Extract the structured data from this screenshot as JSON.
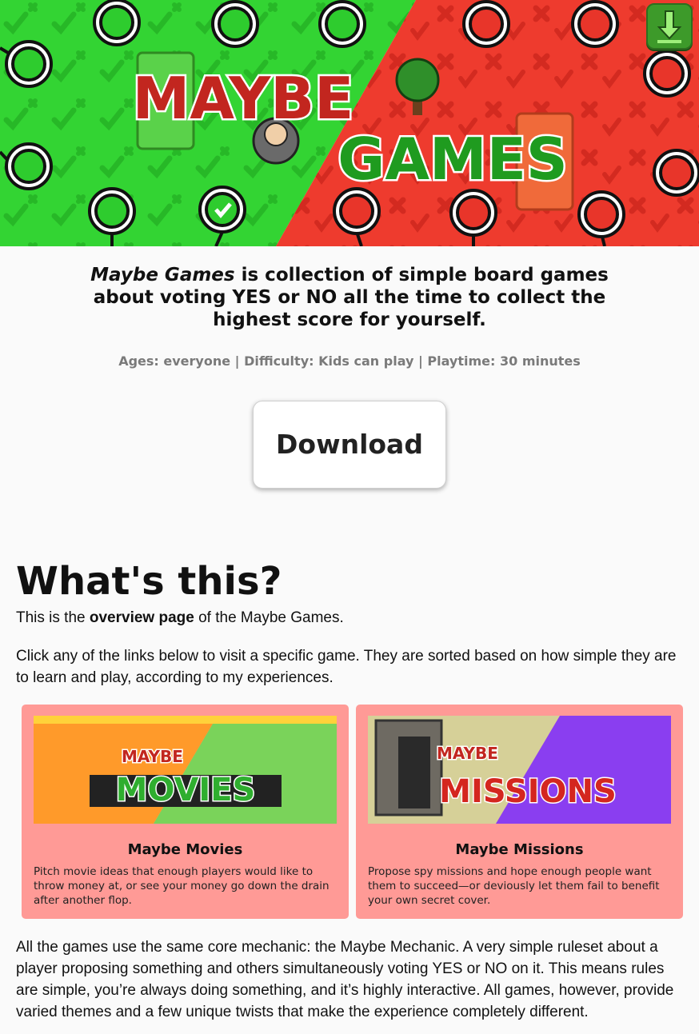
{
  "hero": {
    "logo_word_1": "MAYBE",
    "logo_word_2": "GAMES",
    "colors": {
      "yes_green": "#2ecc2e",
      "no_red": "#e8352a",
      "logo_red": "#c2261f"
    },
    "corner_icon": "download-arrow-icon"
  },
  "intro": {
    "title_italic": "Maybe Games",
    "rest": " is collection of simple board games about voting YES or NO all the time to collect the highest score for yourself."
  },
  "meta": "Ages: everyone | Difficulty: Kids can play | Playtime: 30 minutes",
  "download_label": "Download",
  "overview": {
    "heading": "What's this?",
    "p1_before": "This is the ",
    "p1_bold": "overview page",
    "p1_after": " of the Maybe Games.",
    "p2": "Click any of the links below to visit a specific game. They are sorted based on how simple they are to learn and play, according to my experiences."
  },
  "cards": [
    {
      "title": "Maybe Movies",
      "desc": "Pitch movie ideas that enough players would like to throw money at, or see your money go down the drain after another flop.",
      "thumb_word": "MOVIES"
    },
    {
      "title": "Maybe Missions",
      "desc": "Propose spy missions and hope enough people want them to succeed—or deviously let them fail to benefit your own secret cover.",
      "thumb_word": "MISSIONS"
    }
  ],
  "bottom_paragraph": "All the games use the same core mechanic: the Maybe Mechanic. A very simple ruleset about a player proposing something and others simultaneously voting YES or NO on it. This means rules are simple, you’re always doing something, and it’s highly interactive. All games, however, provide varied themes and a few unique twists that make the experience completely different."
}
